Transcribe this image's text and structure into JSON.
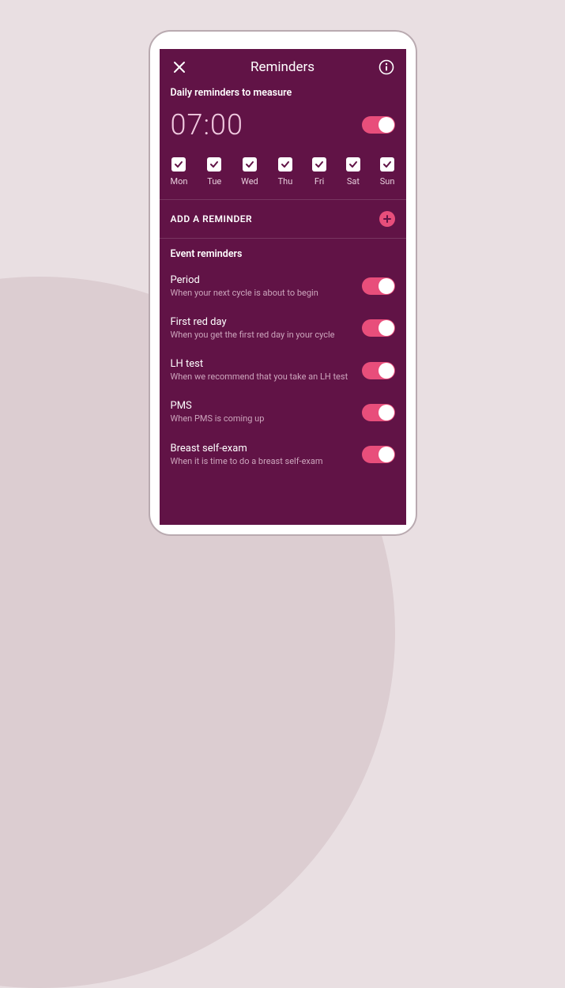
{
  "header": {
    "title": "Reminders"
  },
  "daily": {
    "section_label": "Daily reminders to measure",
    "time": "07:00",
    "days": [
      {
        "label": "Mon",
        "checked": true
      },
      {
        "label": "Tue",
        "checked": true
      },
      {
        "label": "Wed",
        "checked": true
      },
      {
        "label": "Thu",
        "checked": true
      },
      {
        "label": "Fri",
        "checked": true
      },
      {
        "label": "Sat",
        "checked": true
      },
      {
        "label": "Sun",
        "checked": true
      }
    ]
  },
  "add_reminder_label": "ADD A REMINDER",
  "events": {
    "section_label": "Event reminders",
    "items": [
      {
        "title": "Period",
        "desc": "When your next cycle is about to begin",
        "on": true
      },
      {
        "title": "First red day",
        "desc": "When you get the first red day in your cycle",
        "on": true
      },
      {
        "title": "LH test",
        "desc": "When we recommend that you take an LH test",
        "on": true
      },
      {
        "title": "PMS",
        "desc": "When PMS is coming up",
        "on": true
      },
      {
        "title": "Breast self-exam",
        "desc": "When it is time to do a breast self-exam",
        "on": true
      }
    ]
  }
}
